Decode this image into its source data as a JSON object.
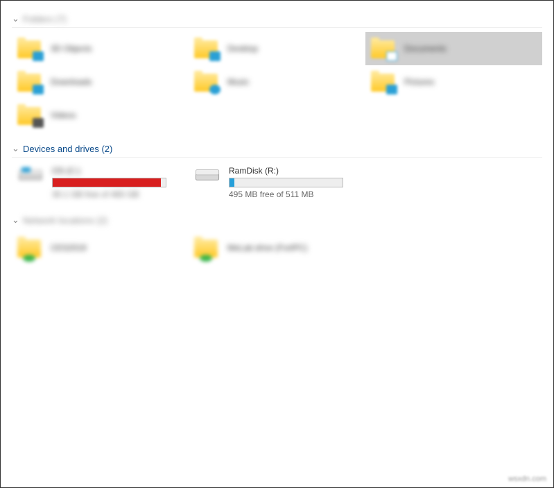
{
  "sections": {
    "folders": {
      "label": "Folders (7)"
    },
    "drives": {
      "label": "Devices and drives (2)"
    },
    "network": {
      "label": "Network locations (2)"
    }
  },
  "folders": [
    {
      "label": "3D Objects"
    },
    {
      "label": "Desktop"
    },
    {
      "label": "Documents",
      "selected": true
    },
    {
      "label": "Downloads"
    },
    {
      "label": "Music"
    },
    {
      "label": "Pictures"
    },
    {
      "label": "Videos"
    }
  ],
  "drives": [
    {
      "name": "OS (C:)",
      "free": "30.1 GB free of 465 GB",
      "fill_pct": 96,
      "fill_color": "red"
    },
    {
      "name": "RamDisk (R:)",
      "free": "495 MB free of 511 MB",
      "fill_pct": 4,
      "fill_color": "blue"
    }
  ],
  "network": [
    {
      "label": "CES2019"
    },
    {
      "label": "MeLab drive (FortPC)"
    }
  ],
  "watermark": "wsxdn.com"
}
